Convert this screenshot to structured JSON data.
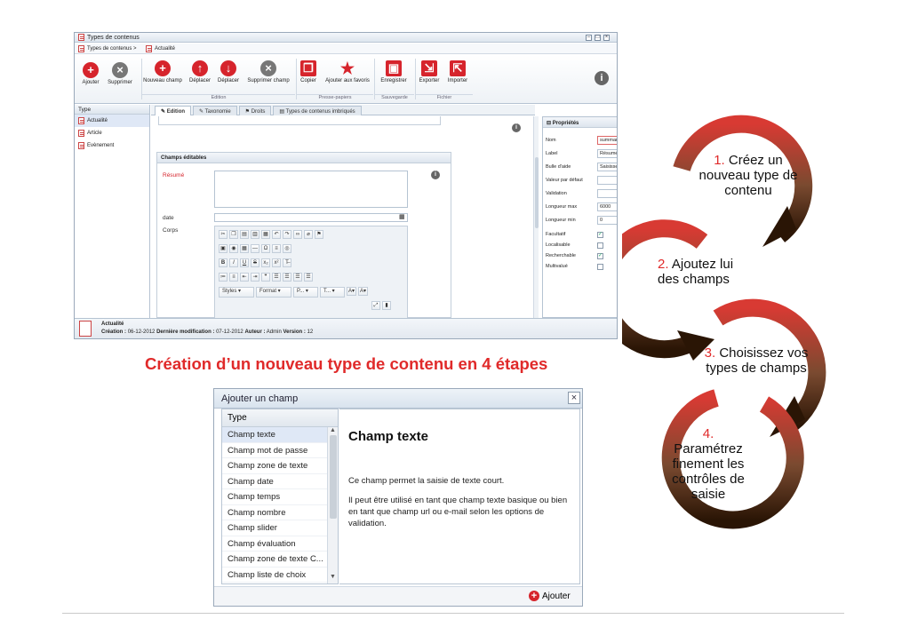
{
  "app": {
    "window_title": "Types de contenus",
    "breadcrumb": [
      "Types de contenus >",
      "Actualité"
    ],
    "ribbon": {
      "buttons": [
        {
          "label": "Ajouter",
          "icon": "plus-icon"
        },
        {
          "label": "Supprimer",
          "icon": "x-icon"
        },
        {
          "label": "Nouveau champ",
          "icon": "plus-icon"
        },
        {
          "label": "Déplacer",
          "icon": "arrow-up-icon"
        },
        {
          "label": "Déplacer",
          "icon": "arrow-down-icon"
        },
        {
          "label": "Supprimer champ",
          "icon": "x-icon"
        },
        {
          "label": "Copier",
          "icon": "copy-icon"
        },
        {
          "label": "Ajouter aux favoris",
          "icon": "star-icon"
        },
        {
          "label": "Enregistrer",
          "icon": "save-icon"
        },
        {
          "label": "Exporter",
          "icon": "export-icon"
        },
        {
          "label": "Importer",
          "icon": "import-icon"
        }
      ],
      "groups": [
        "Edition",
        "Presse-papiers",
        "Sauvegarde",
        "Fichier"
      ]
    },
    "tree": {
      "header": "Type",
      "items": [
        "Actualité",
        "Article",
        "Evènement"
      ]
    },
    "tabs": [
      "Edition",
      "Taxonomie",
      "Droits",
      "Types de contenus imbriqués"
    ],
    "editor": {
      "section_title": "Champs éditables",
      "fields": {
        "resume": "Résumé",
        "date": "date",
        "corps": "Corps"
      },
      "toolbar": {
        "row4": [
          "Styles",
          "Format",
          "P...",
          "T..."
        ]
      }
    },
    "props": {
      "title": "Propriétés",
      "rows": [
        {
          "k": "Nom",
          "v": "summary"
        },
        {
          "k": "Label",
          "v": "Résumé"
        },
        {
          "k": "Bulle d'aide",
          "v": "Saisissez le résumé de l'actuali"
        },
        {
          "k": "Valeur par défaut",
          "v": ""
        },
        {
          "k": "Validation",
          "v": ""
        },
        {
          "k": "Longueur max",
          "v": "6000"
        },
        {
          "k": "Longueur min",
          "v": "0"
        }
      ],
      "checks": [
        {
          "k": "Facultatif",
          "checked": true
        },
        {
          "k": "Localisable",
          "checked": false
        },
        {
          "k": "Recherchable",
          "checked": true
        },
        {
          "k": "Multivalué",
          "checked": false
        }
      ]
    },
    "status": {
      "name": "Actualité",
      "creation_label": "Création :",
      "creation": "06-12-2012",
      "modif_label": "Dernière modification :",
      "modif": "07-12-2012",
      "author_label": "Auteur :",
      "author": "Admin",
      "version_label": "Version :",
      "version": "12"
    }
  },
  "headline": "Création d’un nouveau type de contenu en 4 étapes",
  "dialog": {
    "title": "Ajouter un champ",
    "list_header": "Type",
    "items": [
      "Champ texte",
      "Champ mot de passe",
      "Champ zone de texte",
      "Champ date",
      "Champ temps",
      "Champ nombre",
      "Champ slider",
      "Champ évaluation",
      "Champ zone de texte C...",
      "Champ liste de choix"
    ],
    "desc_title": "Champ texte",
    "desc_p1": "Ce champ permet la saisie de texte court.",
    "desc_p2": "Il peut être utilisé en tant que champ texte basique ou bien en tant que champ url ou e-mail selon les options de validation.",
    "add_button": "Ajouter"
  },
  "steps": [
    {
      "num": "1.",
      "text": "Créez un nouveau type de contenu"
    },
    {
      "num": "2.",
      "text": "Ajoutez lui des champs"
    },
    {
      "num": "3.",
      "text": "Choisissez vos types de champs"
    },
    {
      "num": "4.",
      "text": "Paramétrez finement les contrôles de saisie"
    }
  ],
  "colors": {
    "accent": "#e02a2a",
    "arrow_top": "#d83a33",
    "arrow_bottom": "#2a1505"
  }
}
